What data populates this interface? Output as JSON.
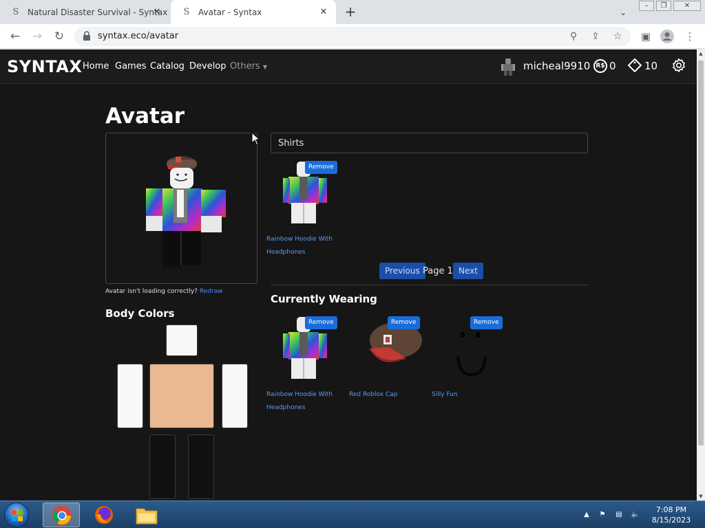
{
  "browser": {
    "tabs": [
      {
        "title": "Natural Disaster Survival - Syntax",
        "icon": "syntax-logo-icon"
      },
      {
        "title": "Avatar - Syntax",
        "icon": "syntax-logo-icon"
      }
    ],
    "url": "syntax.eco/avatar"
  },
  "site": {
    "brand": "SYNTAX",
    "nav": {
      "home": "Home",
      "games": "Games",
      "catalog": "Catalog",
      "develop": "Develop",
      "others": "Others"
    },
    "user": {
      "name": "micheal9910",
      "robux": "0",
      "robux_icon_text": "R$",
      "tickets": "10"
    }
  },
  "page": {
    "title": "Avatar",
    "avatar_note": "Avatar isn't loading correctly?",
    "redraw": "Redraw",
    "body_colors_title": "Body Colors",
    "category_value": "Shirts",
    "inventory": [
      {
        "name": "Rainbow Hoodie With Headphones",
        "remove": "Remove",
        "kind": "hoodie"
      }
    ],
    "pager": {
      "previous": "Previous",
      "label": "Page 1",
      "next": "Next"
    },
    "wearing_title": "Currently Wearing",
    "wearing": [
      {
        "name": "Rainbow Hoodie With Headphones",
        "remove": "Remove",
        "kind": "hoodie"
      },
      {
        "name": "Red Roblox Cap",
        "remove": "Remove",
        "kind": "cap"
      },
      {
        "name": "Silly Fun",
        "remove": "Remove",
        "kind": "face"
      }
    ]
  },
  "body_colors": {
    "head": "#f8f8f8",
    "torso": "#eab892",
    "left_arm": "#f8f8f8",
    "right_arm": "#f8f8f8",
    "left_leg": "#111111",
    "right_leg": "#111111"
  },
  "taskbar": {
    "time": "7:08 PM",
    "date": "8/15/2023"
  },
  "colors": {
    "site_bg": "#161616",
    "accent": "#1a6cdb",
    "link": "#5b9cf7"
  }
}
